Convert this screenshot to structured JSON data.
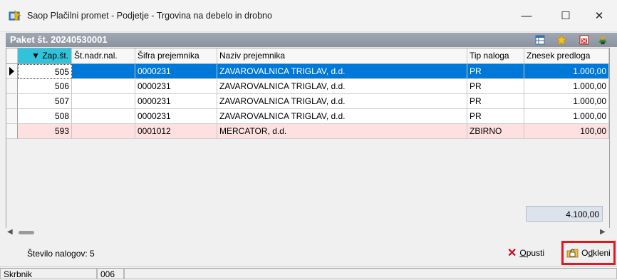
{
  "window": {
    "title": "Saop Plačilni promet - Podjetje - Trgovina na debelo in drobno",
    "minimize_glyph": "—",
    "maximize_glyph": "☐",
    "close_glyph": "✕"
  },
  "panel": {
    "title": "Paket št. 20240530001",
    "icons": [
      "grid-settings-icon",
      "star-icon",
      "delete-icon",
      "exit-icon"
    ]
  },
  "table": {
    "columns": [
      "▼ Zap.št.",
      "Št.nadr.nal.",
      "Šifra prejemnika",
      "Naziv prejemnika",
      "Tip naloga",
      "Znesek predloga"
    ],
    "rows": [
      {
        "zap": "505",
        "nadr": "",
        "sifra": "0000231",
        "naziv": "ZAVAROVALNICA TRIGLAV, d.d.",
        "tip": "PR",
        "znesek": "1.000,00"
      },
      {
        "zap": "506",
        "nadr": "",
        "sifra": "0000231",
        "naziv": "ZAVAROVALNICA TRIGLAV, d.d.",
        "tip": "PR",
        "znesek": "1.000,00"
      },
      {
        "zap": "507",
        "nadr": "",
        "sifra": "0000231",
        "naziv": "ZAVAROVALNICA TRIGLAV, d.d.",
        "tip": "PR",
        "znesek": "1.000,00"
      },
      {
        "zap": "508",
        "nadr": "",
        "sifra": "0000231",
        "naziv": "ZAVAROVALNICA TRIGLAV, d.d.",
        "tip": "PR",
        "znesek": "1.000,00"
      },
      {
        "zap": "593",
        "nadr": "",
        "sifra": "0001012",
        "naziv": "MERCATOR, d.d.",
        "tip": "ZBIRNO",
        "znesek": "100,00"
      }
    ],
    "total": "4.100,00"
  },
  "footer": {
    "count_label": "Število nalogov: 5",
    "cancel_prefix": "O",
    "cancel_rest": "pusti",
    "unlock_prefix": "O",
    "unlock_u": "d",
    "unlock_rest": "kleni"
  },
  "status": {
    "user_label": "Skrbnik",
    "code": "006",
    "extra": ""
  },
  "colors": {
    "selection": "#0078d7",
    "sorted_header": "#32c3dc",
    "pink_row": "#ffe0e0",
    "highlight_border": "#e8141e"
  }
}
